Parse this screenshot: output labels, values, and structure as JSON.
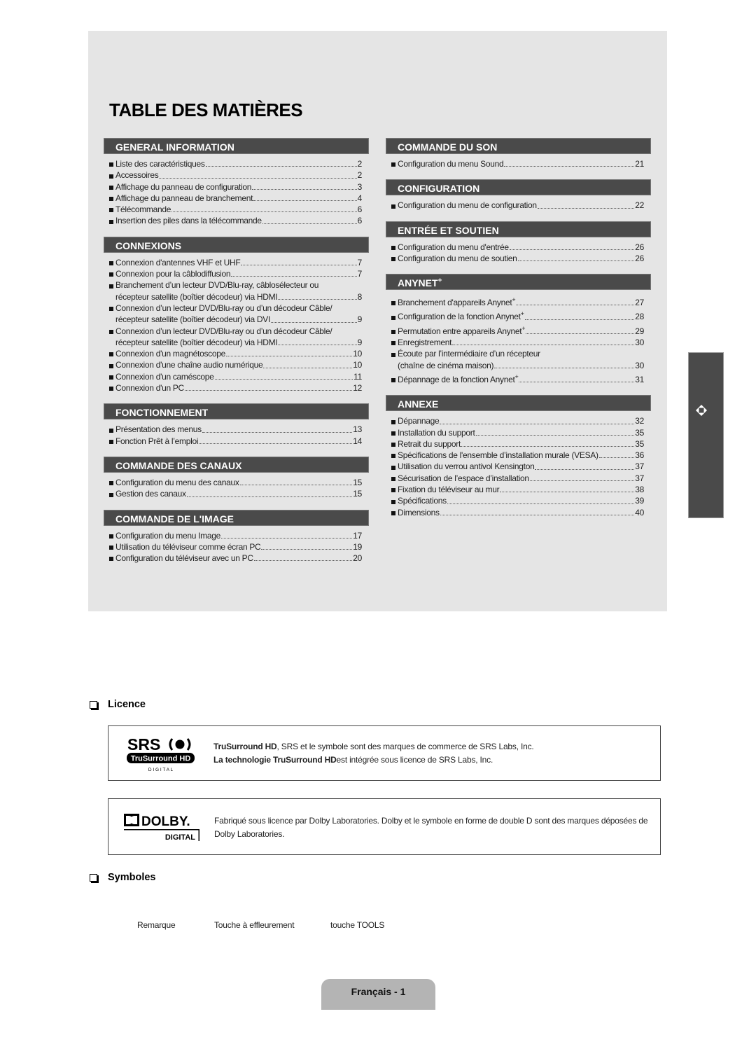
{
  "toc": {
    "title": "TABLE DES MATIÈRES",
    "left_column": [
      {
        "heading": "GENERAL INFORMATION",
        "entries": [
          {
            "title": "Liste des caractéristiques",
            "page": "2"
          },
          {
            "title": "Accessoires",
            "page": "2"
          },
          {
            "title": "Affichage du panneau de configuration",
            "page": "3"
          },
          {
            "title": "Affichage du panneau de branchement",
            "page": "4"
          },
          {
            "title": "Télécommande",
            "page": "6"
          },
          {
            "title": "Insertion des piles dans la télécommande",
            "page": "6"
          }
        ]
      },
      {
        "heading": "CONNEXIONS",
        "entries": [
          {
            "title": "Connexion d'antennes VHF et UHF",
            "page": "7"
          },
          {
            "title": "Connexion pour la câblodiffusion",
            "page": "7"
          },
          {
            "title": "Branchement d’un lecteur DVD/Blu-ray, câblosélecteur ou",
            "title2": "récepteur satellite (boîtier décodeur) via HDMI",
            "page": "8"
          },
          {
            "title": "Connexion d’un lecteur DVD/Blu-ray ou d’un décodeur Câble/",
            "title2": "récepteur satellite (boîtier décodeur) via DVI",
            "page": "9"
          },
          {
            "title": "Connexion d’un lecteur DVD/Blu-ray ou d’un décodeur Câble/",
            "title2": "récepteur satellite (boîtier décodeur) via HDMI",
            "page": "9"
          },
          {
            "title": "Connexion d'un magnétoscope",
            "page": "10"
          },
          {
            "title": "Connexion d'une chaîne audio numérique",
            "page": "10"
          },
          {
            "title": "Connexion d'un caméscope",
            "page": "11"
          },
          {
            "title": "Connexion d'un PC",
            "page": "12"
          }
        ]
      },
      {
        "heading": "FONCTIONNEMENT",
        "entries": [
          {
            "title": "Présentation des menus",
            "page": "13"
          },
          {
            "title": "Fonction Prêt à l’emploi",
            "page": "14"
          }
        ]
      },
      {
        "heading": "COMMANDE DES CANAUX",
        "entries": [
          {
            "title": "Configuration du menu des canaux",
            "page": "15"
          },
          {
            "title": "Gestion des canaux",
            "page": "15"
          }
        ]
      },
      {
        "heading": "COMMANDE DE L'IMAGE",
        "entries": [
          {
            "title": "Configuration du menu Image",
            "page": "17"
          },
          {
            "title": "Utilisation du téléviseur comme écran PC",
            "page": "19"
          },
          {
            "title": "Configuration du téléviseur avec un PC",
            "page": "20"
          }
        ]
      }
    ],
    "right_column": [
      {
        "heading": "COMMANDE DU SON",
        "entries": [
          {
            "title": "Configuration du menu Sound",
            "page": "21"
          }
        ]
      },
      {
        "heading": "CONFIGURATION",
        "entries": [
          {
            "title": "Configuration du menu de configuration",
            "page": "22"
          }
        ]
      },
      {
        "heading": "ENTRÉE ET SOUTIEN",
        "entries": [
          {
            "title": "Configuration du menu d'entrée",
            "page": "26"
          },
          {
            "title": "Configuration du menu de soutien",
            "page": "26"
          }
        ]
      },
      {
        "heading": "ANYNET",
        "heading_sup": "+",
        "entries": [
          {
            "title": "Branchement d'appareils Anynet",
            "sup": "+",
            "page": "27"
          },
          {
            "title": "Configuration de la fonction Anynet",
            "sup": "+",
            "page": "28"
          },
          {
            "title": "Permutation entre appareils Anynet",
            "sup": "+",
            "page": "29"
          },
          {
            "title": "Enregistrement",
            "page": "30"
          },
          {
            "title": "Écoute par l’intermédiaire d’un récepteur",
            "title2": "(chaîne de cinéma maison)",
            "page": "30"
          },
          {
            "title": "Dépannage de la fonction Anynet",
            "sup": "+",
            "page": "31"
          }
        ]
      },
      {
        "heading": "ANNEXE",
        "entries": [
          {
            "title": "Dépannage",
            "page": "32"
          },
          {
            "title": "Installation du support",
            "page": "35"
          },
          {
            "title": "Retrait du support",
            "page": "35"
          },
          {
            "title": "Spécifications de l'ensemble d’installation murale (VESA)",
            "page": "36"
          },
          {
            "title": "Utilisation du verrou antivol Kensington",
            "page": "37"
          },
          {
            "title": "Sécurisation de l’espace d’installation",
            "page": "37"
          },
          {
            "title": "Fixation du téléviseur au mur",
            "page": "38"
          },
          {
            "title": "Spécifications",
            "page": "39"
          },
          {
            "title": "Dimensions",
            "page": "40"
          }
        ]
      }
    ]
  },
  "side_tab": {
    "icon": "navigation-diamond-icon"
  },
  "licence": {
    "heading": "Licence",
    "srs": {
      "logo_text": "SRS",
      "logo_sub": "TruSurround HD",
      "logo_digital": "D I G I T A L",
      "line1_bold": "TruSurround HD",
      "line1_rest": ", SRS et le symbole sont des marques de commerce de SRS Labs, Inc.",
      "line2_bold": "La technologie TruSurround HD",
      "line2_rest": "est intégrée sous licence de SRS Labs, Inc."
    },
    "dolby": {
      "logo_text": "DOLBY.",
      "logo_sub": "DIGITAL",
      "text": "Fabriqué sous licence par Dolby Laboratories. Dolby et le symbole en forme de double D sont des marques déposées de Dolby Laboratories."
    }
  },
  "symbols": {
    "heading": "Symboles",
    "items": [
      "Remarque",
      "Touche à effleurement",
      "touche TOOLS"
    ]
  },
  "footer": {
    "page_label": "Français - 1"
  },
  "colors": {
    "panel_bg": "#e5e5e5",
    "section_header": "#4a4a4a",
    "footer_tab": "#b4b4b4"
  }
}
